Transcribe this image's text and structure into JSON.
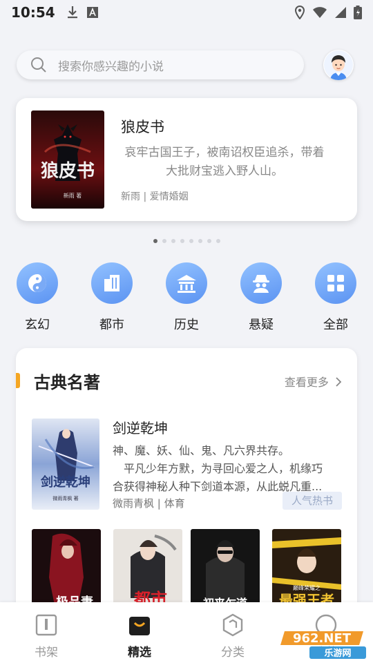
{
  "status": {
    "time": "10:54"
  },
  "search": {
    "placeholder": "搜索你感兴趣的小说"
  },
  "banner": {
    "title": "狼皮书",
    "description": "哀牢古国王子，被南诏权臣追杀，带着大批财宝逃入野人山。",
    "meta": "新雨 | 爱情婚姻",
    "cover_text": "狼皮书",
    "cover_author": "新雨 著"
  },
  "carousel": {
    "count": 8,
    "active_index": 0
  },
  "categories": [
    {
      "label": "玄幻",
      "icon": "yin-yang-icon"
    },
    {
      "label": "都市",
      "icon": "buildings-icon"
    },
    {
      "label": "历史",
      "icon": "temple-icon"
    },
    {
      "label": "悬疑",
      "icon": "detective-icon"
    },
    {
      "label": "全部",
      "icon": "grid-icon"
    }
  ],
  "section": {
    "title": "古典名著",
    "more_label": "查看更多",
    "featured": {
      "title": "剑逆乾坤",
      "desc_line1": "神、魔、妖、仙、鬼、凡六界共存。",
      "desc_line2": "　平凡少年方默，为寻回心爱之人，机缘巧",
      "desc_line3": "合获得神秘人种下剑道本源，从此蜕凡重...",
      "meta": "微雨青枫 | 体育",
      "tag": "人气热书",
      "cover_text": "剑逆乾坤",
      "cover_author": "微雨青枫 著"
    },
    "grid_covers": [
      {
        "cover_text": "极品妻"
      },
      {
        "cover_text": "都市"
      },
      {
        "cover_text": "初来乍道"
      },
      {
        "cover_text": "最强王者",
        "cover_subtext": "巅峰荣耀之"
      }
    ]
  },
  "tabbar": [
    {
      "label": "书架",
      "icon": "bookshelf-icon",
      "active": false
    },
    {
      "label": "精选",
      "icon": "bag-icon",
      "active": true
    },
    {
      "label": "分类",
      "icon": "hexagon-icon",
      "active": false
    },
    {
      "label": "我的",
      "icon": "profile-icon",
      "active": false
    }
  ],
  "watermark": {
    "text_top": "962.NET",
    "text_bottom": "乐游网"
  }
}
